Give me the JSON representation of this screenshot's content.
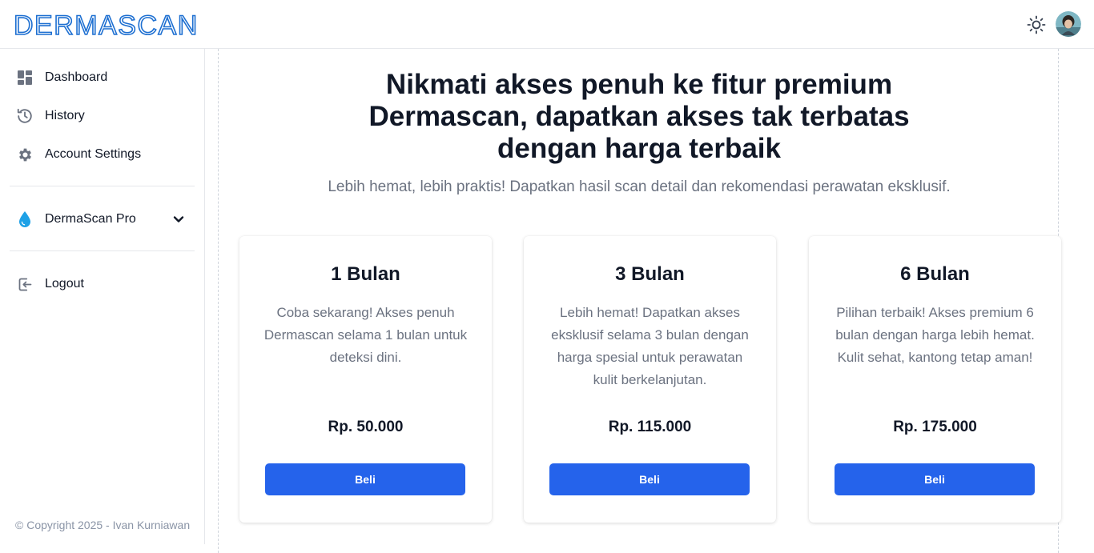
{
  "app": {
    "logo_text": "DERMASCAN"
  },
  "sidebar": {
    "items": [
      {
        "label": "Dashboard",
        "icon": "dashboard-icon"
      },
      {
        "label": "History",
        "icon": "history-icon"
      },
      {
        "label": "Account Settings",
        "icon": "gear-icon"
      }
    ],
    "pro": {
      "label": "DermaScan Pro",
      "icon": "droplet-icon",
      "accent": "#1ea1e6"
    },
    "logout": {
      "label": "Logout",
      "icon": "logout-icon"
    },
    "copyright": "© Copyright 2025 - Ivan Kurniawan"
  },
  "main": {
    "headline_lines": [
      "Nikmati akses penuh ke fitur premium",
      "Dermascan, dapatkan akses tak terbatas",
      "dengan harga terbaik"
    ],
    "subheadline": "Lebih hemat, lebih praktis! Dapatkan hasil scan detail dan rekomendasi perawatan eksklusif.",
    "plans": [
      {
        "title": "1 Bulan",
        "description": "Coba sekarang! Akses penuh Dermascan selama 1 bulan untuk deteksi dini.",
        "price": "Rp. 50.000",
        "button": "Beli"
      },
      {
        "title": "3 Bulan",
        "description": "Lebih hemat! Dapatkan akses eksklusif selama 3 bulan dengan harga spesial untuk perawatan kulit berkelanjutan.",
        "price": "Rp. 115.000",
        "button": "Beli"
      },
      {
        "title": "6 Bulan",
        "description": "Pilihan terbaik! Akses premium 6 bulan dengan harga lebih hemat. Kulit sehat, kantong tetap aman!",
        "price": "Rp. 175.000",
        "button": "Beli"
      }
    ]
  },
  "colors": {
    "brand": "#1d6fd1",
    "primary_button": "#2563eb"
  }
}
